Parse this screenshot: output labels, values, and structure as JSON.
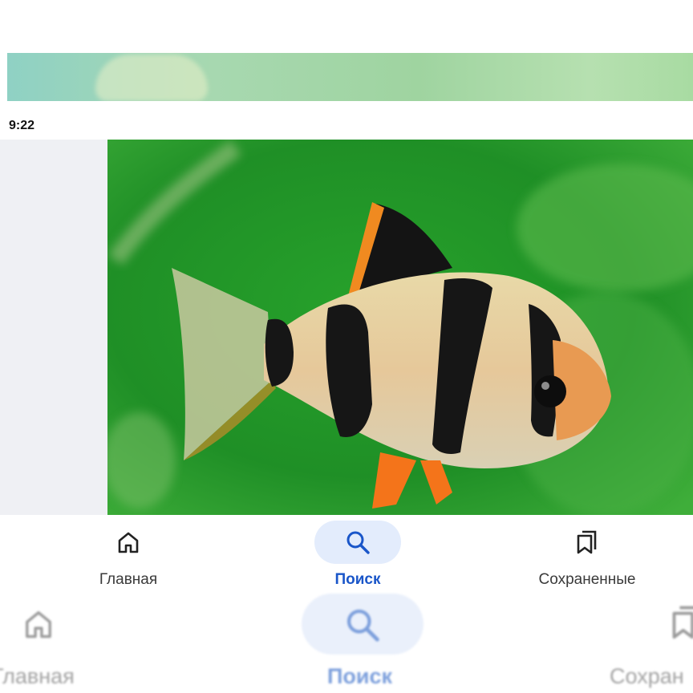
{
  "status_bar": {
    "time": "9:22"
  },
  "colors": {
    "accent": "#1a56c9",
    "pill": "#e3ecfc",
    "label": "#3a3a3a"
  },
  "photo": {
    "subject": "tiger barb fish",
    "icon": "fish-photo"
  },
  "bottom_nav": {
    "items": [
      {
        "label": "Главная",
        "icon": "home-icon",
        "active": false
      },
      {
        "label": "Поиск",
        "icon": "search-icon",
        "active": true
      },
      {
        "label": "Сохраненные",
        "icon": "bookmarks-icon",
        "active": false
      }
    ]
  },
  "background_nav": {
    "items": [
      {
        "label": "Главная",
        "icon": "home-icon"
      },
      {
        "label": "Поиск",
        "icon": "search-icon"
      },
      {
        "label": "Сохран",
        "icon": "bookmarks-icon"
      }
    ]
  }
}
